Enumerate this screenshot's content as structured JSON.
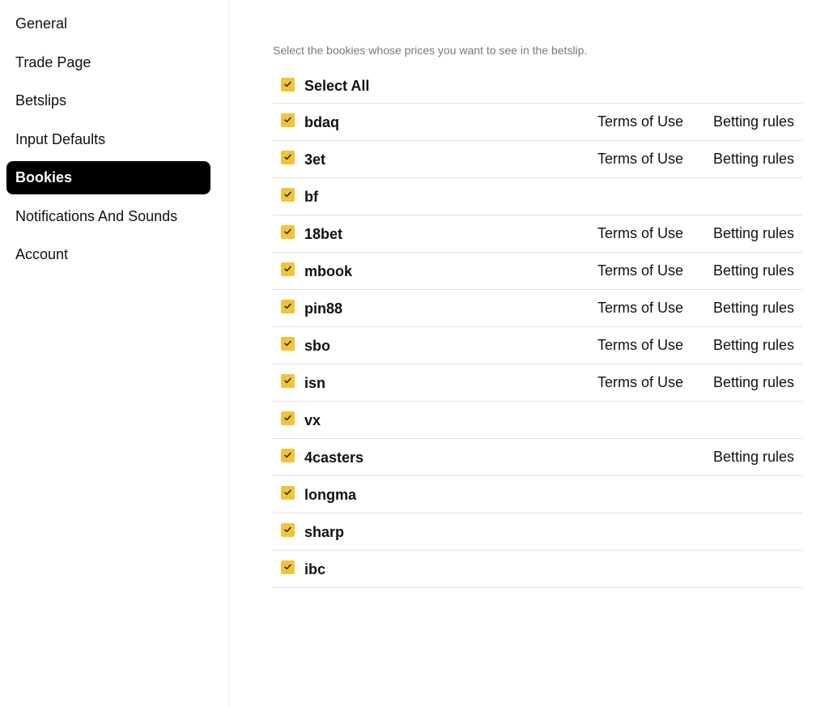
{
  "sidebar": {
    "items": [
      {
        "label": "General",
        "active": false
      },
      {
        "label": "Trade Page",
        "active": false
      },
      {
        "label": "Betslips",
        "active": false
      },
      {
        "label": "Input Defaults",
        "active": false
      },
      {
        "label": "Bookies",
        "active": true
      },
      {
        "label": "Notifications And Sounds",
        "active": false
      },
      {
        "label": "Account",
        "active": false
      }
    ]
  },
  "main": {
    "description": "Select the bookies whose prices you want to see in the betslip.",
    "select_all": {
      "label": "Select All",
      "checked": true
    },
    "terms_label": "Terms of Use",
    "rules_label": "Betting rules",
    "bookies": [
      {
        "name": "bdaq",
        "checked": true,
        "terms": true,
        "rules": true
      },
      {
        "name": "3et",
        "checked": true,
        "terms": true,
        "rules": true
      },
      {
        "name": "bf",
        "checked": true,
        "terms": false,
        "rules": false
      },
      {
        "name": "18bet",
        "checked": true,
        "terms": true,
        "rules": true
      },
      {
        "name": "mbook",
        "checked": true,
        "terms": true,
        "rules": true
      },
      {
        "name": "pin88",
        "checked": true,
        "terms": true,
        "rules": true
      },
      {
        "name": "sbo",
        "checked": true,
        "terms": true,
        "rules": true
      },
      {
        "name": "isn",
        "checked": true,
        "terms": true,
        "rules": true
      },
      {
        "name": "vx",
        "checked": true,
        "terms": false,
        "rules": false
      },
      {
        "name": "4casters",
        "checked": true,
        "terms": false,
        "rules": true
      },
      {
        "name": "longma",
        "checked": true,
        "terms": false,
        "rules": false
      },
      {
        "name": "sharp",
        "checked": true,
        "terms": false,
        "rules": false
      },
      {
        "name": "ibc",
        "checked": true,
        "terms": false,
        "rules": false
      }
    ]
  },
  "colors": {
    "checkbox": "#f0c43a",
    "active_nav_bg": "#000000",
    "description_text": "#7a7a7a"
  },
  "icons": {
    "checkmark": "check-icon"
  }
}
